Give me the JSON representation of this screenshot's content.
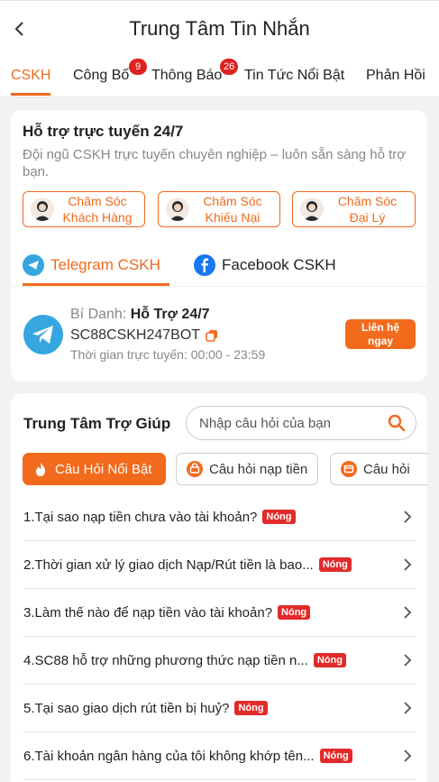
{
  "header": {
    "title": "Trung Tâm Tin Nhắn",
    "back_icon": "chevron-left-icon"
  },
  "tabs": [
    {
      "label": "CSKH",
      "active": true
    },
    {
      "label": "Công Bố",
      "badge": "9"
    },
    {
      "label": "Thông Báo",
      "badge": "26"
    },
    {
      "label": "Tin Tức Nổi Bật"
    },
    {
      "label": "Phản Hồi"
    }
  ],
  "support": {
    "title": "Hỗ trợ trực tuyến 24/7",
    "description": "Đội ngũ CSKH trực tuyến chuyên nghiệp – luôn sẵn sàng hỗ trợ bạn.",
    "agents": [
      {
        "label": "Chăm Sóc\nKhách Hàng"
      },
      {
        "label": "Chăm Sóc\nKhiếu Nại"
      },
      {
        "label": "Chăm Sóc\nĐại Lý"
      }
    ],
    "channel_tabs": [
      {
        "label": "Telegram CSKH",
        "active": true,
        "icon": "telegram-icon"
      },
      {
        "label": "Facebook CSKH",
        "icon": "facebook-icon"
      }
    ],
    "contact": {
      "alias_label": "Bí Danh:",
      "alias_value": "Hỗ Trợ 24/7",
      "bot_id": "SC88CSKH247BOT",
      "online_time": "Thời gian trực tuyến: 00:00 - 23:59",
      "join_button": "Liên hệ\nngay"
    }
  },
  "help": {
    "title": "Trung Tâm Trợ Giúp",
    "search_placeholder": "Nhập câu hỏi của bạn",
    "chips": [
      {
        "label": "Câu Hỏi Nổi Bật",
        "active": true,
        "icon": "flame-icon"
      },
      {
        "label": "Câu hỏi nạp tiền",
        "icon": "deposit-icon"
      },
      {
        "label": "Câu hỏi",
        "icon": "withdraw-icon"
      }
    ],
    "hot_label": "Nóng",
    "faqs": [
      {
        "question": "1.Tại sao nạp tiền chưa vào tài khoản?"
      },
      {
        "question": "2.Thời gian xử lý giao dịch Nạp/Rút tiền là bao..."
      },
      {
        "question": "3.Làm thế nào để nạp tiền vào tài khoản?"
      },
      {
        "question": "4.SC88 hỗ trợ những phương thức nạp tiền n..."
      },
      {
        "question": "5.Tại sao giao dịch rút tiền bị huỷ?"
      },
      {
        "question": "6.Tài khoản ngân hàng của tôi không khớp tên..."
      }
    ]
  },
  "colors": {
    "accent": "#f26a1b",
    "badge": "#e02121",
    "telegram": "#35a6e0",
    "facebook": "#1877f2"
  }
}
